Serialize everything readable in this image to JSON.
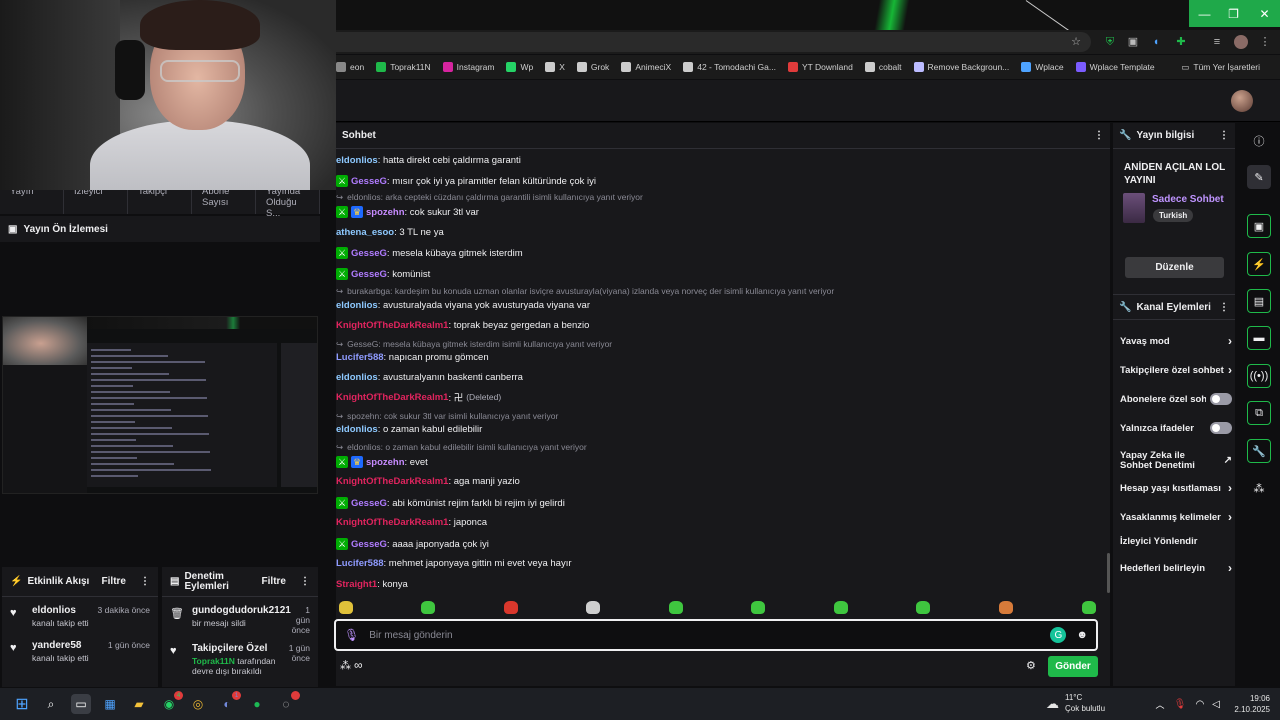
{
  "browser": {
    "bookmarks": [
      {
        "label": "eon",
        "color": "#888888"
      },
      {
        "label": "Toprak11N",
        "color": "#1fb94a"
      },
      {
        "label": "Instagram",
        "color": "#d6249f"
      },
      {
        "label": "Wp",
        "color": "#25d366"
      },
      {
        "label": "X",
        "color": "#cccccc"
      },
      {
        "label": "Grok",
        "color": "#cccccc"
      },
      {
        "label": "AnimeciX",
        "color": "#cccccc"
      },
      {
        "label": "42 - Tomodachi Ga...",
        "color": "#cccccc"
      },
      {
        "label": "YT Downland",
        "color": "#e03b3b"
      },
      {
        "label": "cobalt",
        "color": "#cccccc"
      },
      {
        "label": "Remove Backgroun...",
        "color": "#bbbbff"
      },
      {
        "label": "Wplace",
        "color": "#4ea3ff"
      },
      {
        "label": "Wplace Template",
        "color": "#7b5cff"
      }
    ],
    "all_bookmarks": "Tüm Yer İşaretleri"
  },
  "dashboard": {
    "stats": [
      "Yayın",
      "İzleyici",
      "Takipçi",
      "Abone Sayısı",
      "Yayında Olduğu S..."
    ],
    "preview_title": "Yayın Ön İzlemesi",
    "activity": {
      "title": "Etkinlik Akışı",
      "filter": "Filtre",
      "items": [
        {
          "name": "eldonlios",
          "sub": "kanalı takip etti",
          "time": "3 dakika önce"
        },
        {
          "name": "yandere58",
          "sub": "kanalı takip etti",
          "time": "1 gün önce"
        }
      ]
    },
    "mod": {
      "title": "Denetim Eylemleri",
      "filter": "Filtre",
      "items": [
        {
          "name": "gundogdudoruk2121",
          "sub": "bir mesajı sildi",
          "time": "1 gün önce"
        },
        {
          "name": "Takipçilere Özel",
          "sub_user": "Toprak11N",
          "sub": "tarafından devre dışı bırakıldı",
          "time": "1 gün önce"
        }
      ]
    }
  },
  "chat": {
    "title": "Sohbet",
    "input_placeholder": "Bir mesaj gönderin",
    "send": "Gönder",
    "colors": {
      "eldonlios": "#8ec9ff",
      "GesseG": "#b07cff",
      "spozehn": "#c78bff",
      "athena_esoo": "#8ec9ff",
      "KnightOfTheDarkRealm1": "#e0245e",
      "Lucifer588": "#8f9bff",
      "Straight1": "#e0245e"
    },
    "messages": [
      {
        "kind": "msg",
        "user": "eldonlios",
        "text": ": hatta direkt cebi çaldırma garanti"
      },
      {
        "kind": "msg",
        "user": "GesseG",
        "text": ": mısır çok iyi ya piramitler felan kültüründe çok iyi",
        "badge": "mod"
      },
      {
        "kind": "reply",
        "text": "eldonlios: arka cepteki cüzdanı çaldırma garantili isimli kullanıcıya yanıt veriyor"
      },
      {
        "kind": "msg",
        "user": "spozehn",
        "text": ": cok sukur 3tl var",
        "badge": "modcrown"
      },
      {
        "kind": "msg",
        "user": "athena_esoo",
        "text": ": 3 TL ne ya"
      },
      {
        "kind": "msg",
        "user": "GesseG",
        "text": ": mesela kübaya gitmek isterdim",
        "badge": "mod"
      },
      {
        "kind": "msg",
        "user": "GesseG",
        "text": ": komünist",
        "badge": "mod"
      },
      {
        "kind": "reply",
        "text": "burakarbga: kardeşim bu konuda uzman olanlar isviçre avusturayla(viyana) izlanda veya norveç der isimli kullanıcıya yanıt veriyor"
      },
      {
        "kind": "msg",
        "user": "eldonlios",
        "text": ": avusturalyada viyana yok avusturyada viyana var"
      },
      {
        "kind": "msg",
        "user": "KnightOfTheDarkRealm1",
        "text": ": toprak beyaz gergedan a benzio"
      },
      {
        "kind": "reply",
        "text": "GesseG: mesela kübaya gitmek isterdim isimli kullanıcıya yanıt veriyor"
      },
      {
        "kind": "msg",
        "user": "Lucifer588",
        "text": ": napıcan promu gömcen"
      },
      {
        "kind": "msg",
        "user": "eldonlios",
        "text": ": avusturalyanın baskenti canberra"
      },
      {
        "kind": "msg",
        "user": "KnightOfTheDarkRealm1",
        "text": ": 卍",
        "deleted": "(Deleted)"
      },
      {
        "kind": "reply",
        "text": "spozehn: cok sukur 3tl var isimli kullanıcıya yanıt veriyor"
      },
      {
        "kind": "msg",
        "user": "eldonlios",
        "text": ": o zaman kabul edilebilir"
      },
      {
        "kind": "reply",
        "text": "eldonlios: o zaman kabul edilebilir isimli kullanıcıya yanıt veriyor"
      },
      {
        "kind": "msg",
        "user": "spozehn",
        "text": ": evet",
        "badge": "modcrown"
      },
      {
        "kind": "msg",
        "user": "KnightOfTheDarkRealm1",
        "text": ": aga manji yazio"
      },
      {
        "kind": "msg",
        "user": "GesseG",
        "text": ": abi kömünist rejim farklı bi rejim iyi gelirdi",
        "badge": "mod"
      },
      {
        "kind": "msg",
        "user": "KnightOfTheDarkRealm1",
        "text": ": japonca"
      },
      {
        "kind": "msg",
        "user": "GesseG",
        "text": ": aaaa japonyada çok iyi",
        "badge": "mod"
      },
      {
        "kind": "msg",
        "user": "Lucifer588",
        "text": ": mehmet japonyaya gittin mi evet veya hayır"
      },
      {
        "kind": "msg",
        "user": "Straight1",
        "text": ": konya"
      }
    ]
  },
  "stream_info": {
    "title": "Yayın bilgisi",
    "stream_title": "ANİDEN AÇILAN LOL YAYINI",
    "category": "Sadece Sohbet",
    "tag": "Turkish",
    "edit": "Düzenle"
  },
  "channel_actions": {
    "title": "Kanal Eylemleri",
    "items": [
      {
        "label": "Yavaş mod",
        "control": "chevron"
      },
      {
        "label": "Takipçilere özel sohbet",
        "control": "chevron"
      },
      {
        "label": "Abonelere özel sohbet",
        "control": "toggle"
      },
      {
        "label": "Yalnızca ifadeler",
        "control": "toggle"
      },
      {
        "label": "Yapay Zeka ile Sohbet Denetimi",
        "control": "external"
      },
      {
        "label": "Hesap yaşı kısıtlaması",
        "control": "chevron"
      },
      {
        "label": "Yasaklanmış kelimeler",
        "control": "chevron"
      },
      {
        "label": "İzleyici Yönlendir",
        "control": "none"
      },
      {
        "label": "Hedefleri belirleyin",
        "control": "chevron"
      }
    ]
  },
  "taskbar": {
    "weather_temp": "11°C",
    "weather_desc": "Çok bulutlu",
    "time": "19:06",
    "date": "2.10.2025"
  }
}
